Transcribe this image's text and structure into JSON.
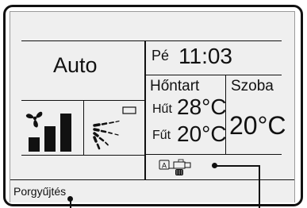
{
  "mode": {
    "label": "Auto"
  },
  "clock": {
    "day": "Pé",
    "time": "11:03"
  },
  "setpoints": {
    "header": "Hőntart",
    "cool_label": "Hűt",
    "cool_value": "28°C",
    "heat_label": "Fűt",
    "heat_value": "20°C"
  },
  "room": {
    "label": "Szoba",
    "value": "20°C"
  },
  "fan": {
    "speed_level": 3,
    "speed_max": 3
  },
  "icons": {
    "fan_speed": "fan-speed-icon",
    "airflow": "airflow-swing-icon",
    "status_indicators": "status-indicators-icon"
  },
  "status_bar": {
    "message": "Porgyűjtés"
  }
}
